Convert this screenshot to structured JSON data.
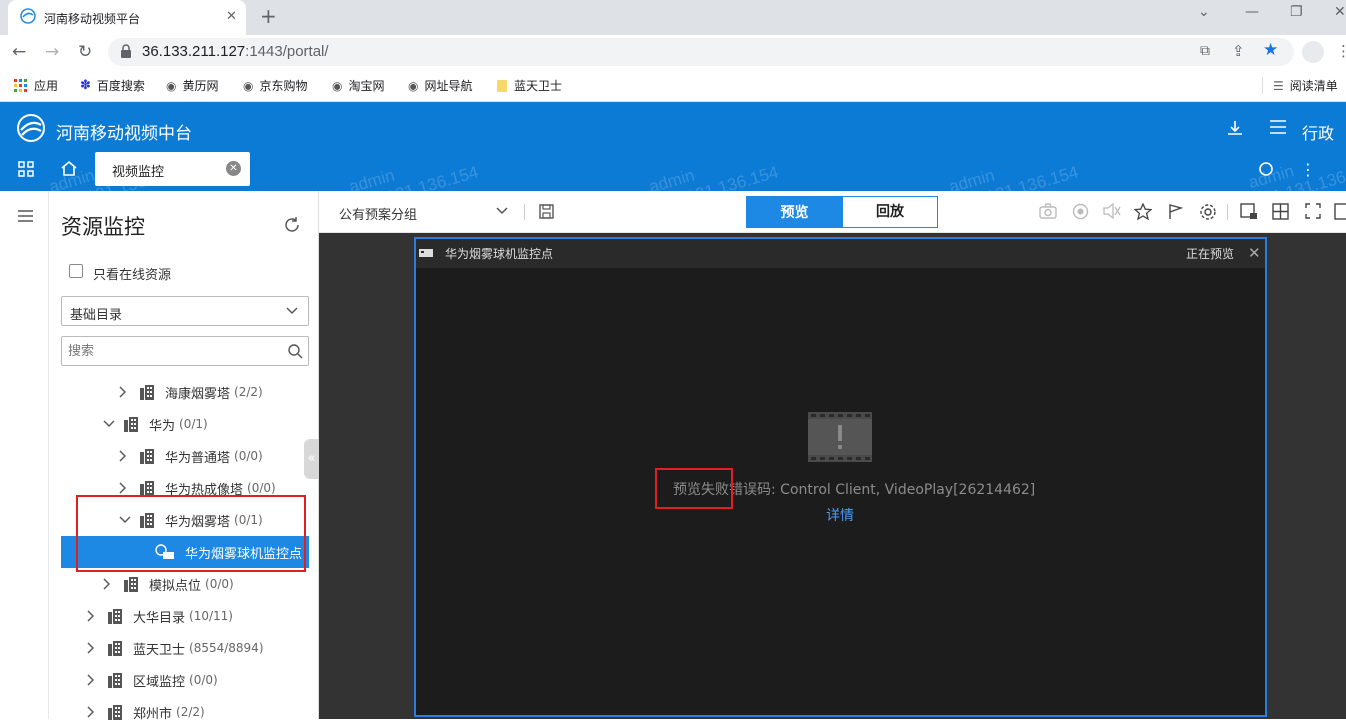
{
  "browser": {
    "tab_title": "河南移动视频平台",
    "url_host": "36.133.211.127",
    "url_rest": ":1443/portal/",
    "bookmarks": [
      "应用",
      "百度搜索",
      "黄历网",
      "京东购物",
      "淘宝网",
      "网址导航",
      "蓝天卫士"
    ],
    "reading_list": "阅读清单"
  },
  "app": {
    "title": "河南移动视频中台",
    "user": "行政",
    "open_tab": "视频监控",
    "watermark_user": "admin",
    "watermark_ip": "221.131.136.154"
  },
  "sidebar": {
    "title": "资源监控",
    "online_only_label": "只看在线资源",
    "directory_select": "基础目录",
    "search_placeholder": "搜索",
    "tree": [
      {
        "label": "海康烟雾塔",
        "count": "(2/2)",
        "level": 2,
        "expanded": false
      },
      {
        "label": "华为",
        "count": "(0/1)",
        "level": 1,
        "expanded": true
      },
      {
        "label": "华为普通塔",
        "count": "(0/0)",
        "level": 2,
        "expanded": false
      },
      {
        "label": "华为热成像塔",
        "count": "(0/0)",
        "level": 2,
        "expanded": false
      },
      {
        "label": "华为烟雾塔",
        "count": "(0/1)",
        "level": 2,
        "expanded": true
      },
      {
        "label": "华为烟雾球机监控点",
        "count": "",
        "level": 3,
        "selected": true
      },
      {
        "label": "模拟点位",
        "count": "(0/0)",
        "level": 1,
        "expanded": false
      },
      {
        "label": "大华目录",
        "count": "(10/11)",
        "level": 0,
        "expanded": false
      },
      {
        "label": "蓝天卫士",
        "count": "(8554/8894)",
        "level": 0,
        "expanded": false
      },
      {
        "label": "区域监控",
        "count": "(0/0)",
        "level": 0,
        "expanded": false
      },
      {
        "label": "郑州市",
        "count": "(2/2)",
        "level": 0,
        "expanded": false
      }
    ]
  },
  "toolbar": {
    "group_select": "公有预案分组",
    "preview_tab": "预览",
    "playback_tab": "回放"
  },
  "video": {
    "pane_title": "华为烟雾球机监控点",
    "pane_status": "正在预览",
    "error_text": "预览失败错误码: Control Client, VideoPlay[26214462]",
    "detail_link": "详情"
  },
  "colors": {
    "brand": "#0b7bd6",
    "accent": "#1e88e5",
    "highlight": "#e02020"
  }
}
